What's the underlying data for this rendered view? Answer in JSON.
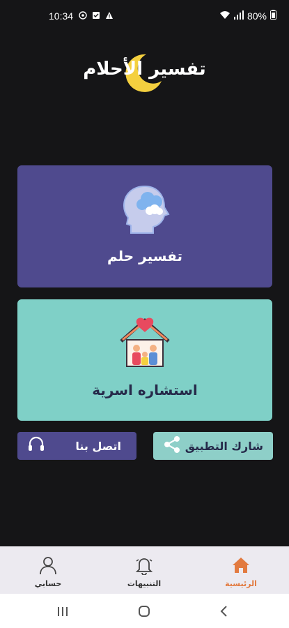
{
  "status_bar": {
    "time": "10:34",
    "battery": "80%",
    "left_icons": [
      "notification-icon",
      "save-icon",
      "alert-icon"
    ],
    "right_icons": [
      "wifi-icon",
      "signal-icon",
      "battery-icon"
    ]
  },
  "app": {
    "logo_text": "تفسير الأحلام",
    "accent_moon_color": "#f4d03f"
  },
  "cards": {
    "dream": {
      "label": "تفسير حلم",
      "color": "#4f4a8e",
      "icon": "head-cloud-icon"
    },
    "family": {
      "label": "استشاره اسرية",
      "color": "#7fd0c7",
      "icon": "family-house-icon"
    }
  },
  "actions": {
    "share": {
      "label": "شارك التطبيق",
      "icon": "share-icon"
    },
    "contact": {
      "label": "اتصل بنا",
      "icon": "headset-icon"
    }
  },
  "bottom_nav": {
    "home": {
      "label": "الرئيسية",
      "icon": "home-icon",
      "active": true,
      "color": "#e27a3f"
    },
    "alerts": {
      "label": "التنبيهات",
      "icon": "bell-icon"
    },
    "account": {
      "label": "حسابي",
      "icon": "user-icon"
    }
  },
  "system_nav": [
    "recent-apps-icon",
    "home-circle-icon",
    "back-icon"
  ]
}
